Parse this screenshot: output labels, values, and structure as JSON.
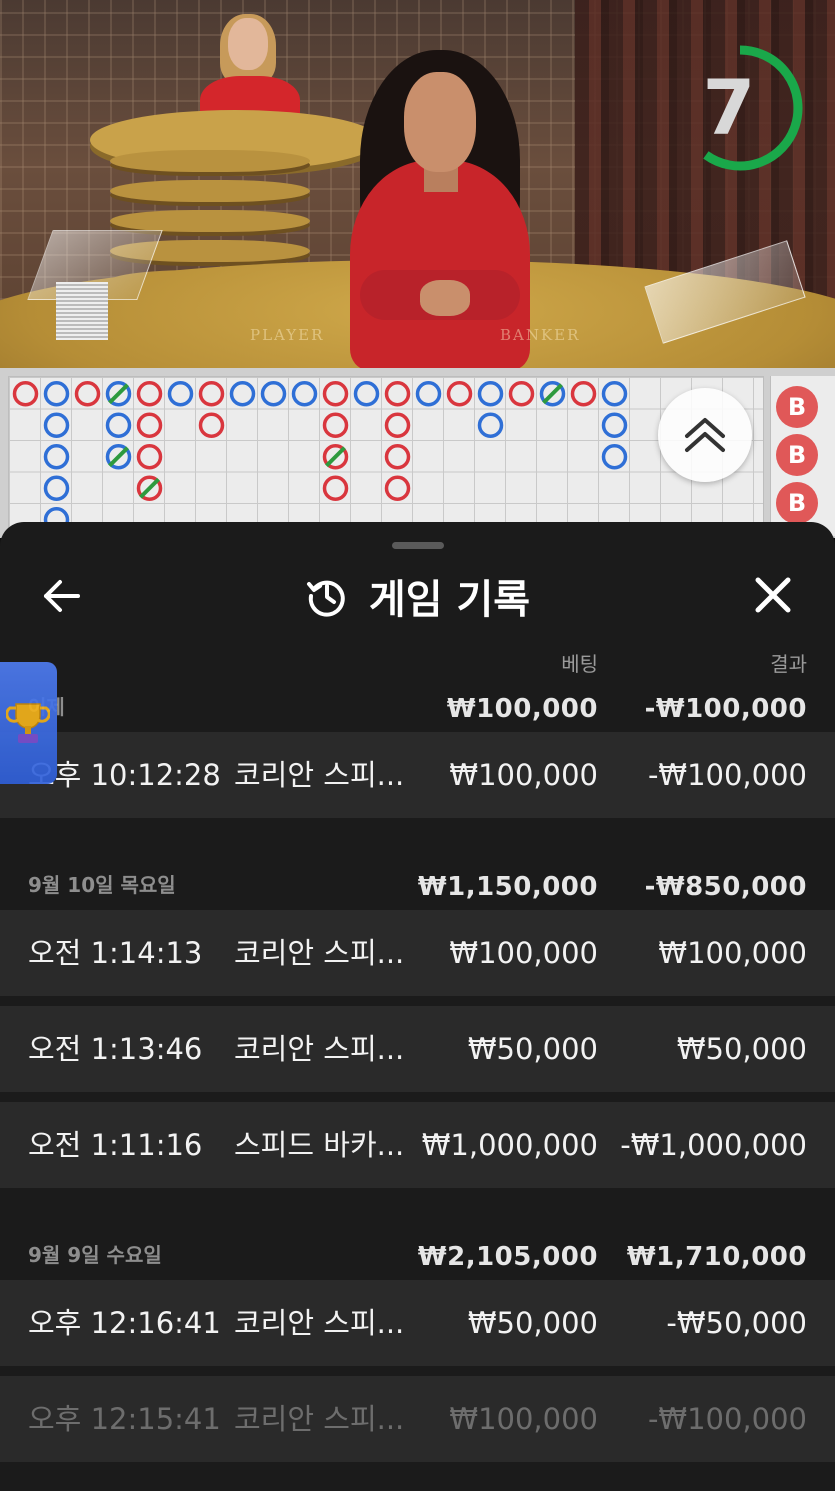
{
  "video": {
    "timer_value": "7",
    "timer_fraction": 0.6,
    "table_labels": [
      "PLAYER",
      "BANKER"
    ]
  },
  "roadmap": {
    "badge_label": "B",
    "colors": {
      "banker": "#d9363e",
      "player": "#2f6fd6",
      "tie": "#2e9a3e"
    }
  },
  "history": {
    "title": "게임 기록",
    "columns": {
      "bet": "베팅",
      "result": "결과"
    },
    "groups": [
      {
        "date": "어제",
        "total_bet": "₩100,000",
        "total_result": "-₩100,000",
        "rows": [
          {
            "time": "오후 10:12:28",
            "game": "코리안 스피...",
            "bet": "₩100,000",
            "result": "-₩100,000"
          }
        ]
      },
      {
        "date": "9월 10일 목요일",
        "total_bet": "₩1,150,000",
        "total_result": "-₩850,000",
        "rows": [
          {
            "time": "오전 1:14:13",
            "game": "코리안 스피...",
            "bet": "₩100,000",
            "result": "₩100,000"
          },
          {
            "time": "오전 1:13:46",
            "game": "코리안 스피...",
            "bet": "₩50,000",
            "result": "₩50,000"
          },
          {
            "time": "오전 1:11:16",
            "game": "스피드 바카...",
            "bet": "₩1,000,000",
            "result": "-₩1,000,000"
          }
        ]
      },
      {
        "date": "9월 9일 수요일",
        "total_bet": "₩2,105,000",
        "total_result": "₩1,710,000",
        "rows": [
          {
            "time": "오후 12:16:41",
            "game": "코리안 스피...",
            "bet": "₩50,000",
            "result": "-₩50,000"
          },
          {
            "time": "오후 12:15:41",
            "game": "코리안 스피...",
            "bet": "₩100,000",
            "result": "-₩100,000"
          }
        ]
      }
    ]
  },
  "icons": {
    "back": "arrow-left-icon",
    "history": "history-clock-icon",
    "close": "close-icon",
    "expand": "chevron-double-up-icon",
    "trophy": "trophy-icon"
  }
}
